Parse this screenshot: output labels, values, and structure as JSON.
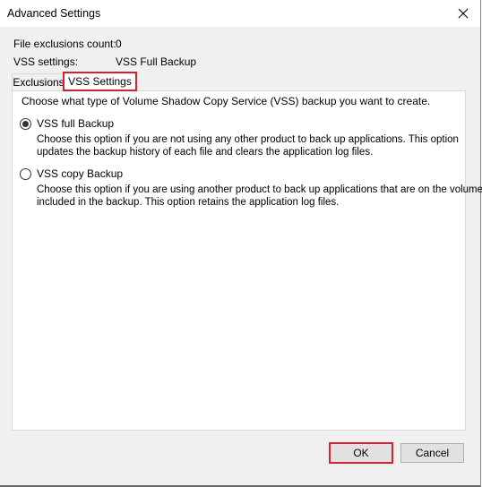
{
  "window": {
    "title": "Advanced Settings",
    "close_icon": "close-icon"
  },
  "info": {
    "file_exclusions_label": "File exclusions count:",
    "file_exclusions_value": "0",
    "vss_settings_label": "VSS settings:",
    "vss_settings_value": "VSS Full Backup"
  },
  "tabs": [
    {
      "label": "Exclusions",
      "active": false
    },
    {
      "label": "VSS Settings",
      "active": true,
      "highlighted": true
    }
  ],
  "vss_panel": {
    "instruction": "Choose what type of Volume Shadow Copy Service (VSS) backup you want to create.",
    "options": [
      {
        "label": "VSS full Backup",
        "selected": true,
        "description_line1": "Choose this option if you are not using any other product to back up applications. This option",
        "description_line2": "updates the backup history of each file and clears the application log files."
      },
      {
        "label": "VSS copy Backup",
        "selected": false,
        "description_line1": "Choose this option if you are using another product to back up applications that are on the volumes",
        "description_line2": "included in the backup. This option retains the application log files."
      }
    ]
  },
  "buttons": {
    "ok_label": "OK",
    "cancel_label": "Cancel"
  },
  "colors": {
    "highlight": "#d9202e",
    "dialog_bg": "#f0f0f0",
    "panel_bg": "#ffffff"
  }
}
